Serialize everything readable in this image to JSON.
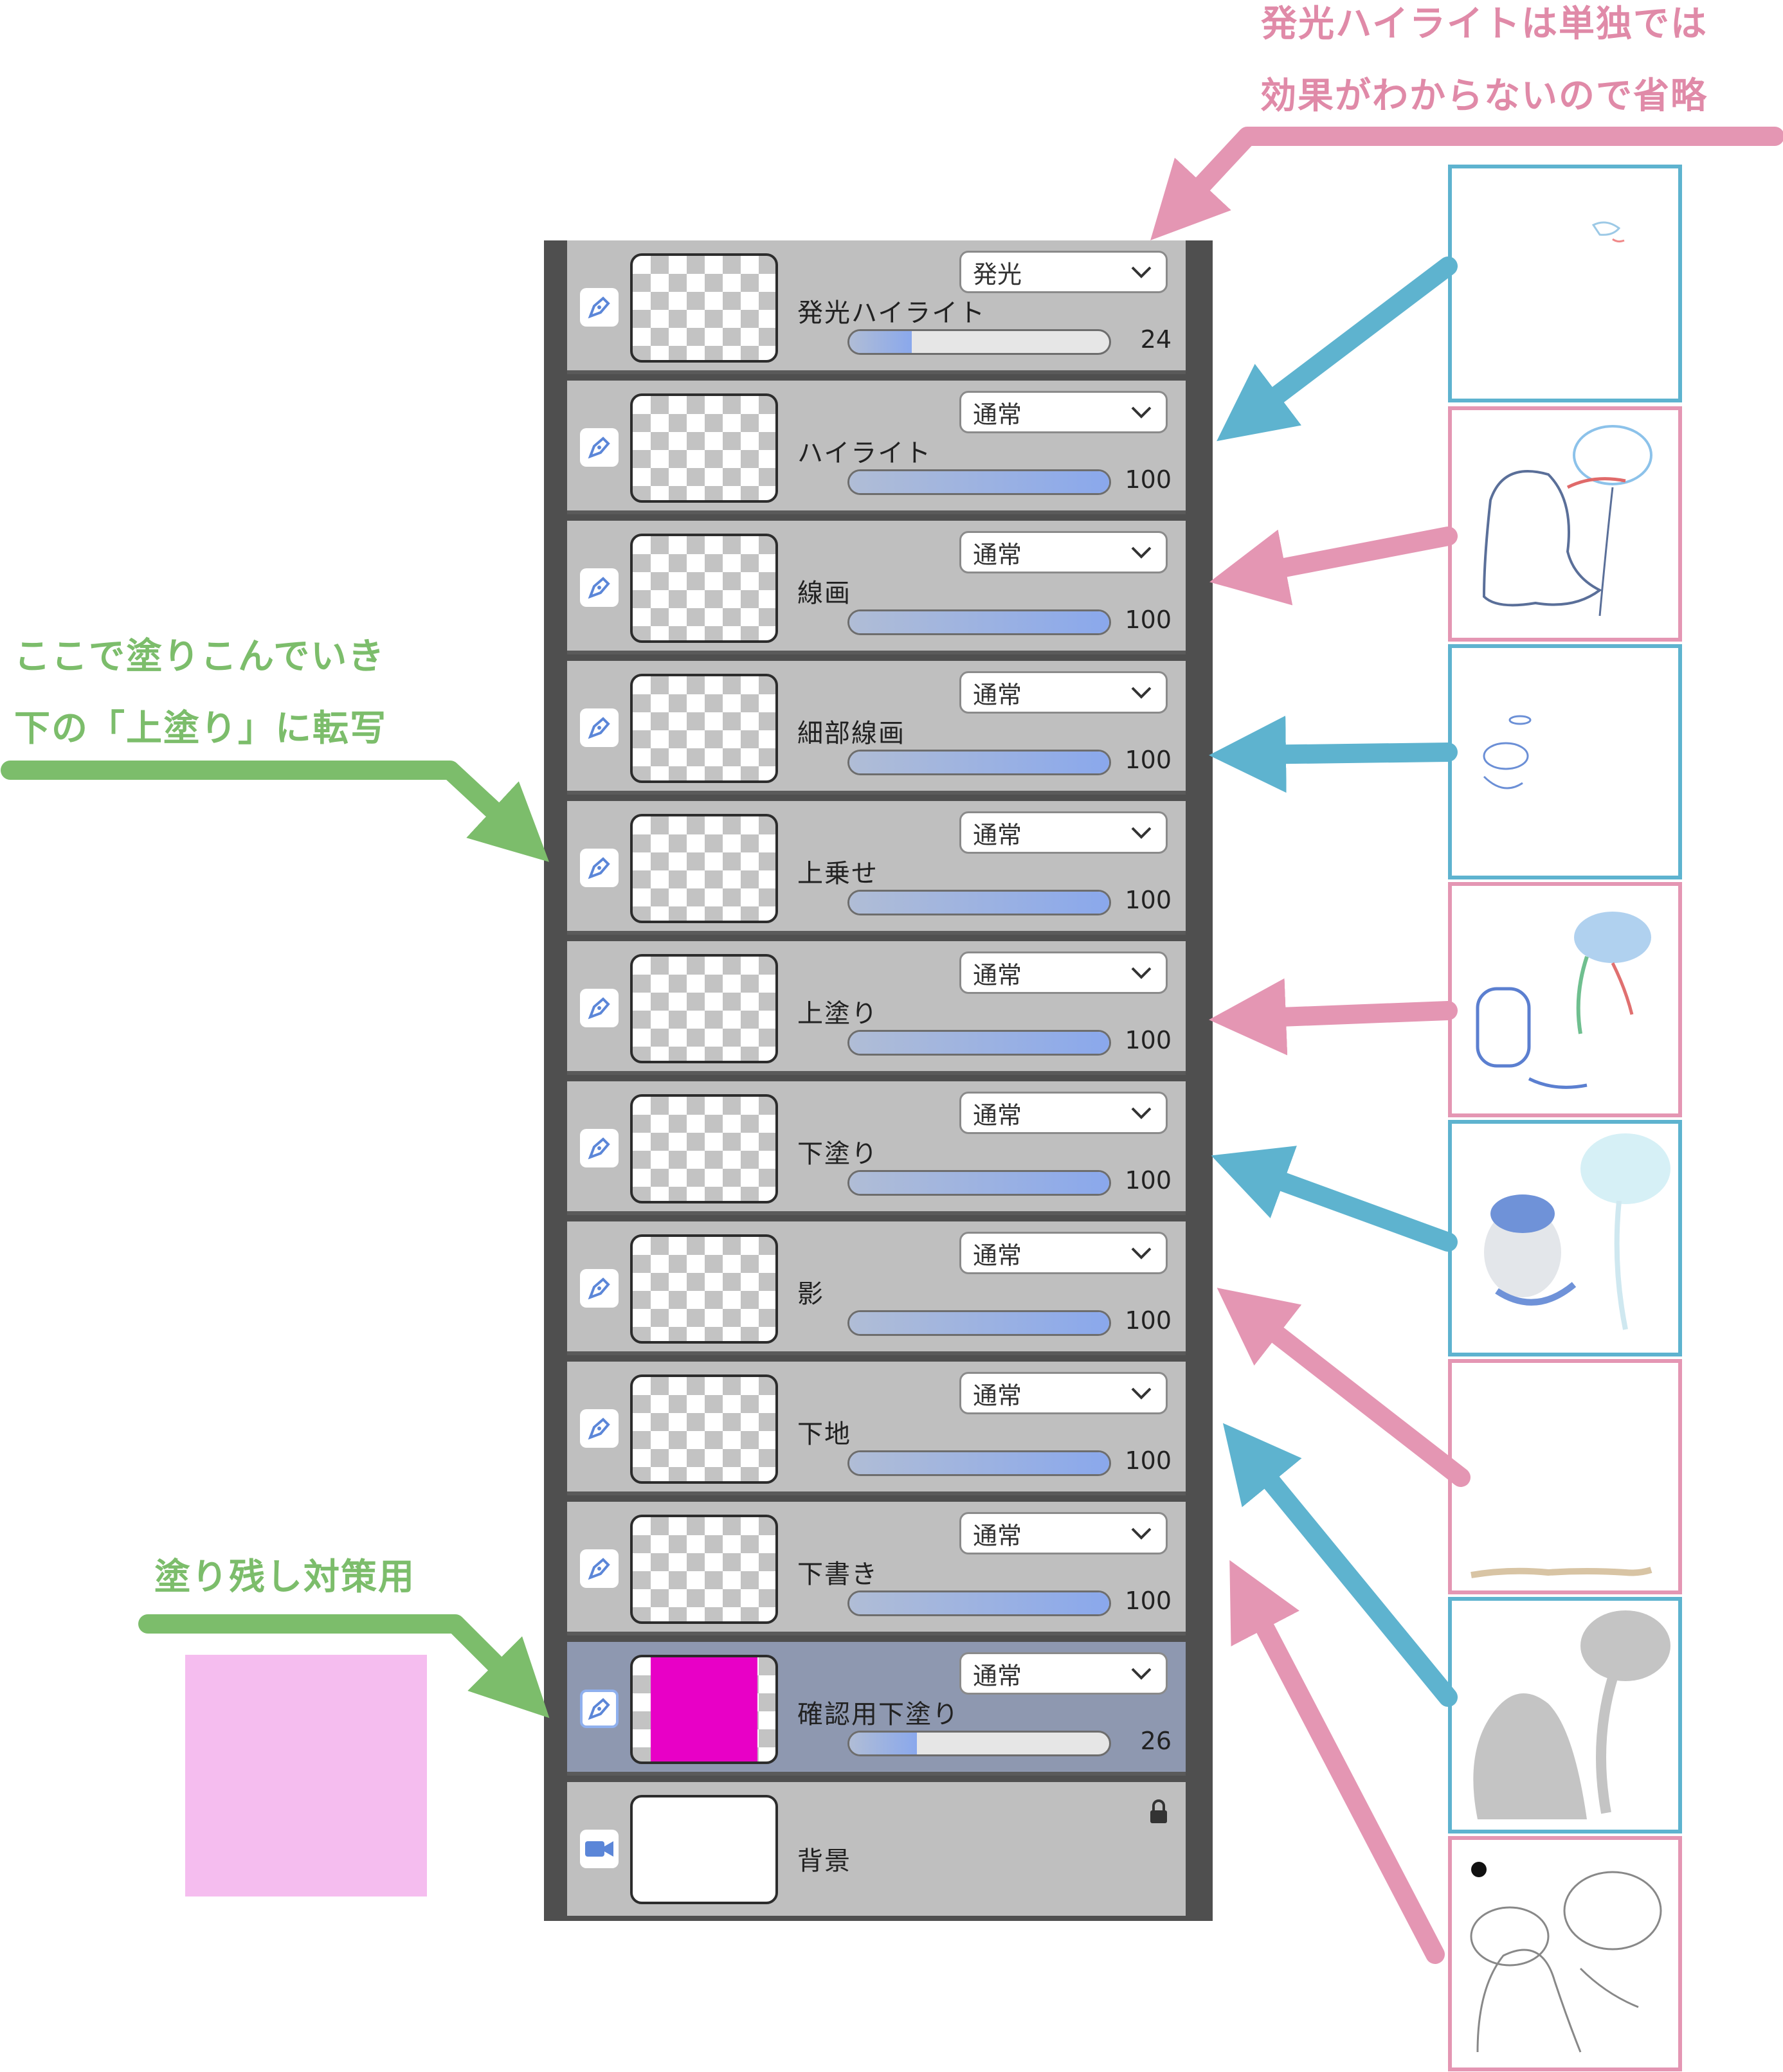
{
  "annotations": {
    "top_right_line1": "発光ハイライトは単独では",
    "top_right_line2": "効果がわからないので省略",
    "left_line1": "ここで塗りこんでいき",
    "left_line2": "下の「上塗り」に転写",
    "bottom_left": "塗り残し対策用"
  },
  "layers": [
    {
      "name": "発光ハイライト",
      "blend": "発光",
      "opacity": "24",
      "opacity_fraction": 0.24
    },
    {
      "name": "ハイライト",
      "blend": "通常",
      "opacity": "100",
      "opacity_fraction": 1.0
    },
    {
      "name": "線画",
      "blend": "通常",
      "opacity": "100",
      "opacity_fraction": 1.0
    },
    {
      "name": "細部線画",
      "blend": "通常",
      "opacity": "100",
      "opacity_fraction": 1.0
    },
    {
      "name": "上乗せ",
      "blend": "通常",
      "opacity": "100",
      "opacity_fraction": 1.0
    },
    {
      "name": "上塗り",
      "blend": "通常",
      "opacity": "100",
      "opacity_fraction": 1.0
    },
    {
      "name": "下塗り",
      "blend": "通常",
      "opacity": "100",
      "opacity_fraction": 1.0
    },
    {
      "name": "影",
      "blend": "通常",
      "opacity": "100",
      "opacity_fraction": 1.0
    },
    {
      "name": "下地",
      "blend": "通常",
      "opacity": "100",
      "opacity_fraction": 1.0
    },
    {
      "name": "下書き",
      "blend": "通常",
      "opacity": "100",
      "opacity_fraction": 1.0
    },
    {
      "name": "確認用下塗り",
      "blend": "通常",
      "opacity": "26",
      "opacity_fraction": 0.26,
      "selected": true
    },
    {
      "name": "背景",
      "locked": true
    }
  ],
  "colors": {
    "pink_accent": "#e496b3",
    "blue_accent": "#5eb3cf",
    "green_accent": "#7cbd6b",
    "confirm_fill": "#e800c6",
    "swatch": "#f5bdef",
    "selected_row": "#8e98b0"
  },
  "icons": {
    "layer_type": "pen-icon",
    "background_type": "camera-icon",
    "dropdown": "chevron-down-icon",
    "locked": "lock-icon"
  }
}
